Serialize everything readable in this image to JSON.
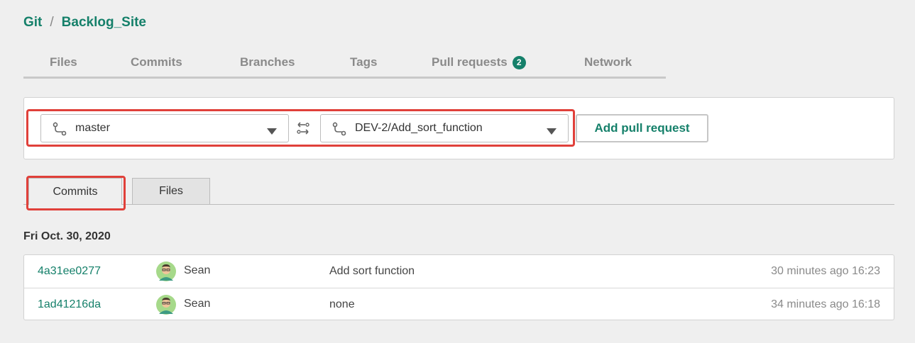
{
  "breadcrumb": {
    "repo_type": "Git",
    "separator": "/",
    "repo_name": "Backlog_Site"
  },
  "nav": {
    "tabs": [
      {
        "label": "Files"
      },
      {
        "label": "Commits"
      },
      {
        "label": "Branches"
      },
      {
        "label": "Tags"
      },
      {
        "label": "Pull requests",
        "badge": "2"
      },
      {
        "label": "Network"
      }
    ]
  },
  "compare": {
    "base_branch": "master",
    "compare_branch": "DEV-2/Add_sort_function",
    "add_button_label": "Add pull request"
  },
  "subtabs": {
    "commits_label": "Commits",
    "files_label": "Files",
    "active": "Commits"
  },
  "commit_groups": [
    {
      "date": "Fri Oct. 30, 2020",
      "commits": [
        {
          "hash": "4a31ee0277",
          "author": "Sean",
          "message": "Add sort function",
          "time": "30 minutes ago 16:23"
        },
        {
          "hash": "1ad41216da",
          "author": "Sean",
          "message": "none",
          "time": "34 minutes ago 16:18"
        }
      ]
    }
  ],
  "colors": {
    "accent": "#15806a",
    "highlight": "#e0403a",
    "background": "#efefef"
  },
  "icons": {
    "branch": "git-branch-icon",
    "caret": "caret-down-icon",
    "swap": "swap-branches-icon",
    "avatar": "user-avatar-icon"
  }
}
